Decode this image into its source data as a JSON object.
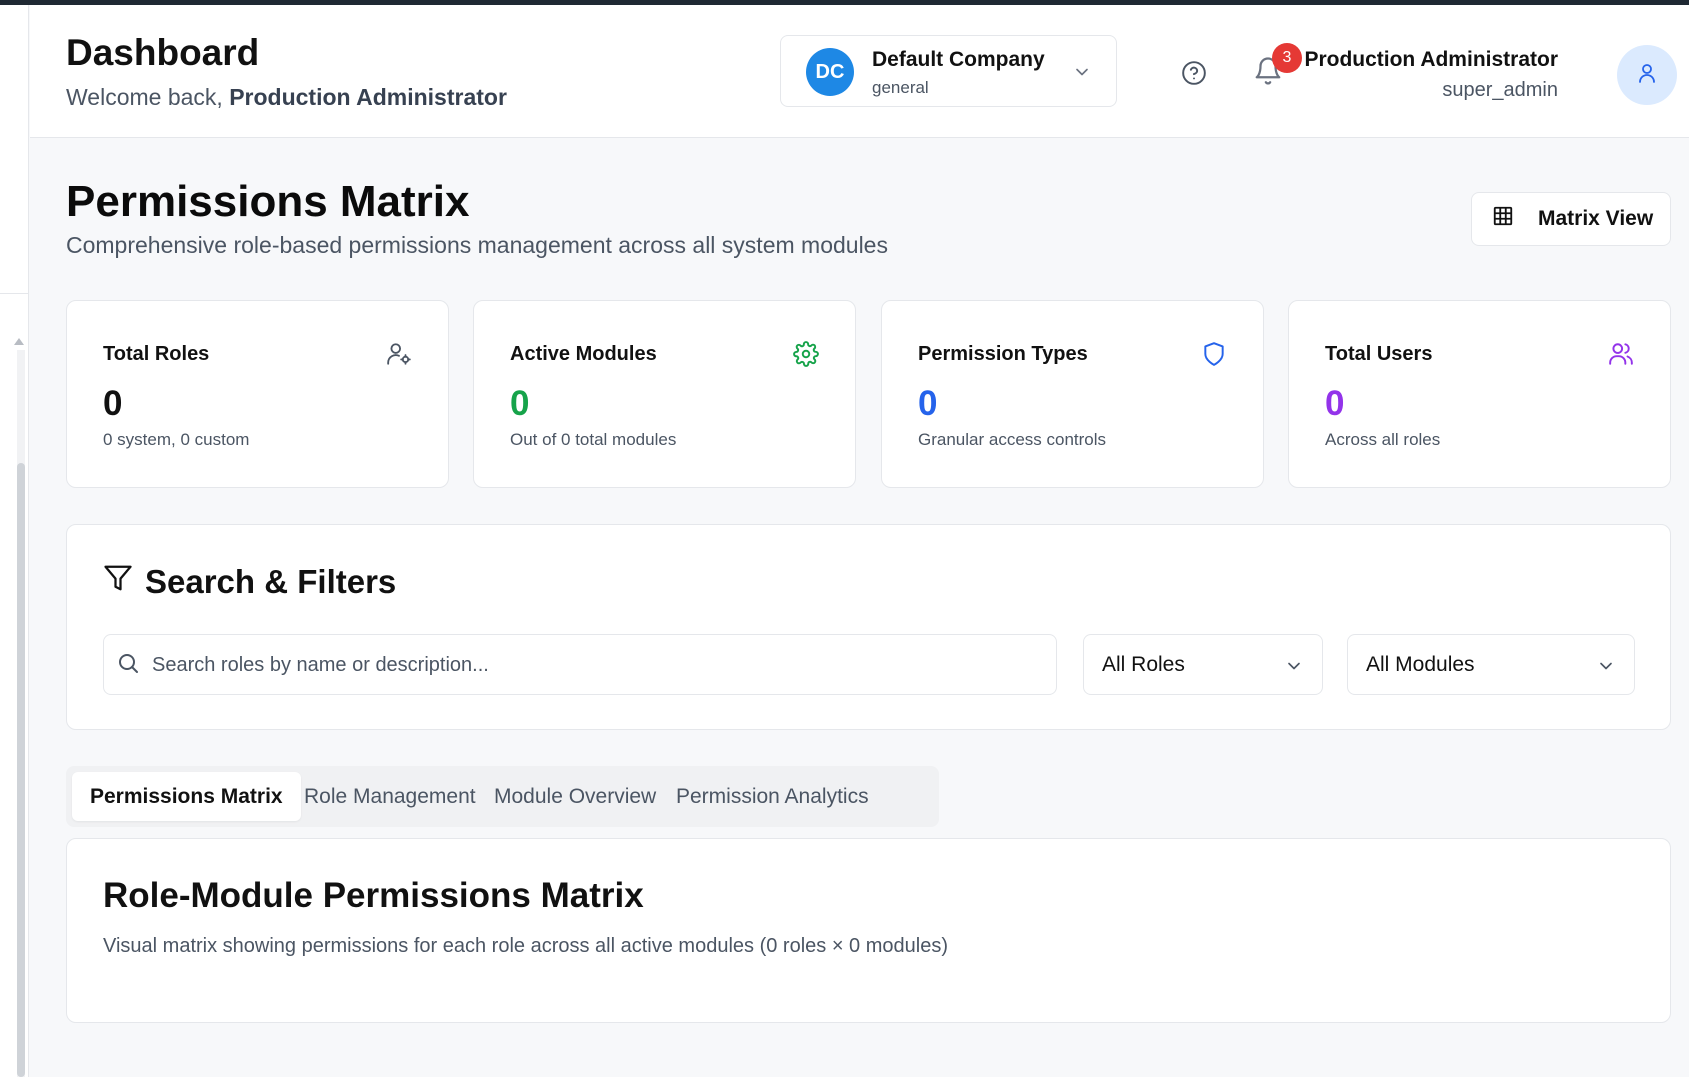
{
  "header": {
    "title": "Dashboard",
    "welcome_prefix": "Welcome back,",
    "welcome_name": "Production Administrator",
    "company": {
      "initials": "DC",
      "name": "Default Company",
      "type": "general"
    },
    "notifications_count": "3",
    "user": {
      "name": "Production Administrator",
      "role": "super_admin"
    }
  },
  "page": {
    "title": "Permissions Matrix",
    "subtitle": "Comprehensive role-based permissions management across all system modules",
    "view_button": "Matrix View"
  },
  "stats": [
    {
      "label": "Total Roles",
      "value": "0",
      "note": "0 system, 0 custom",
      "icon": "user-cog-icon",
      "color": "#111111"
    },
    {
      "label": "Active Modules",
      "value": "0",
      "note": "Out of 0 total modules",
      "icon": "gear-icon",
      "color": "#16a34a"
    },
    {
      "label": "Permission Types",
      "value": "0",
      "note": "Granular access controls",
      "icon": "shield-icon",
      "color": "#2563eb"
    },
    {
      "label": "Total Users",
      "value": "0",
      "note": "Across all roles",
      "icon": "users-icon",
      "color": "#9333ea"
    }
  ],
  "filters": {
    "title": "Search & Filters",
    "search_placeholder": "Search roles by name or description...",
    "roles_select": "All Roles",
    "modules_select": "All Modules"
  },
  "tabs": [
    {
      "label": "Permissions Matrix",
      "active": true
    },
    {
      "label": "Role Management",
      "active": false
    },
    {
      "label": "Module Overview",
      "active": false
    },
    {
      "label": "Permission Analytics",
      "active": false
    }
  ],
  "matrix": {
    "title": "Role-Module Permissions Matrix",
    "subtitle": "Visual matrix showing permissions for each role across all active modules (0 roles × 0 modules)"
  }
}
